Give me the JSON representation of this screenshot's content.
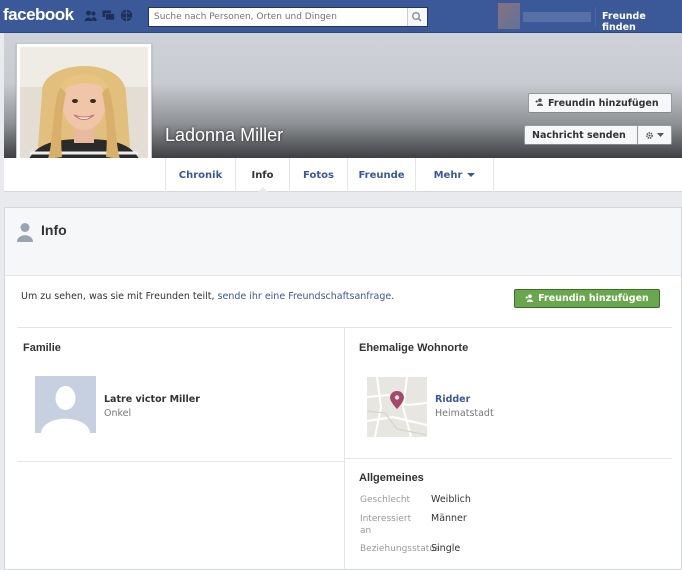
{
  "header": {
    "logo": "facebook",
    "search_placeholder": "Suche nach Personen, Orten und Dingen",
    "find_friends": "Freunde finden"
  },
  "profile": {
    "name": "Ladonna Miller",
    "add_friend": "Freundin hinzufügen",
    "send_message": "Nachricht senden"
  },
  "tabs": [
    {
      "label": "Chronik"
    },
    {
      "label": "Info"
    },
    {
      "label": "Fotos"
    },
    {
      "label": "Freunde"
    },
    {
      "label": "Mehr"
    }
  ],
  "info": {
    "title": "Info",
    "notice_prefix": "Um zu sehen, was sie mit Freunden teilt,",
    "notice_link": "sende ihr eine Freundschaftsanfrage",
    "notice_suffix": ".",
    "add_friend": "Freundin hinzufügen"
  },
  "family": {
    "title": "Familie",
    "members": [
      {
        "name": "Latre victor Miller",
        "relation": "Onkel"
      }
    ]
  },
  "places": {
    "title": "Ehemalige Wohnorte",
    "items": [
      {
        "name": "Ridder",
        "type": "Heimatstadt"
      }
    ]
  },
  "general": {
    "title": "Allgemeines",
    "rows": [
      {
        "label": "Geschlecht",
        "value": "Weiblich"
      },
      {
        "label": "Interessiert an",
        "value": "Männer"
      },
      {
        "label": "Beziehungsstatus",
        "value": "Single"
      }
    ]
  },
  "colors": {
    "brand": "#3b5998",
    "green": "#69a74e",
    "link": "#3b5998"
  }
}
